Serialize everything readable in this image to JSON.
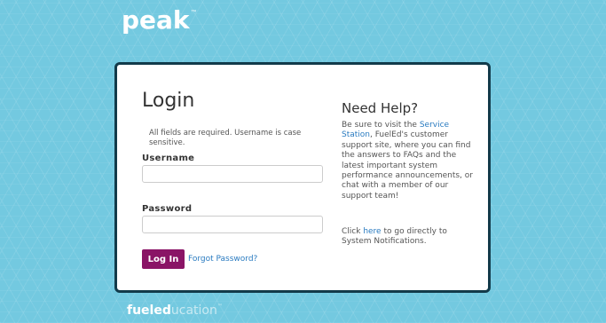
{
  "brand": {
    "logo_text": "peak",
    "logo_mark": "™",
    "footer_bold": "fuel",
    "footer_ed": "ed",
    "footer_light": "ucation",
    "footer_mark": "™"
  },
  "login": {
    "title": "Login",
    "required_note": "All fields are required. Username is case sensitive.",
    "username_label": "Username",
    "username_value": "",
    "password_label": "Password",
    "password_value": "",
    "button_label": "Log In",
    "forgot_label": "Forgot Password?"
  },
  "help": {
    "title": "Need Help?",
    "p1_before": "Be sure to visit the ",
    "p1_link": "Service Station",
    "p1_after": ", FuelEd's customer support site, where you can find the answers to FAQs and the latest important system performance announcements, or chat with a member of our support team!",
    "p2_before": "Click ",
    "p2_link": "here",
    "p2_after": " to go directly to System Notifications."
  },
  "colors": {
    "background": "#73c9e0",
    "card_border": "#123a4a",
    "button": "#8a1466",
    "link": "#2a7bc0"
  }
}
